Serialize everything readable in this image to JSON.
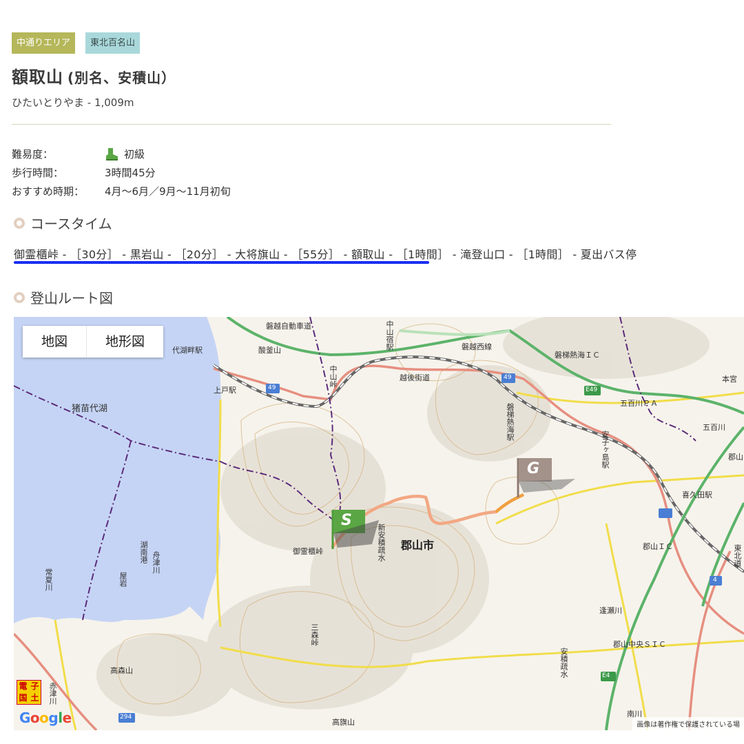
{
  "tags": [
    "中通りエリア",
    "東北百名山"
  ],
  "mountain": {
    "name": "額取山",
    "alias": "(別名、安積山）",
    "reading": "ひたいとりやま - 1,009m"
  },
  "info": {
    "difficulty_label": "難易度：",
    "difficulty_value": "初級",
    "walk_label": "歩行時間：",
    "walk_value": "3時間45分",
    "season_label": "おすすめ時期：",
    "season_value": "4月〜6月／9月〜11月初旬"
  },
  "sections": {
    "course_time": "コースタイム",
    "route_map": "登山ルート図"
  },
  "course": "御霊櫃峠 - ［30分］ - 黒岩山 - ［20分］ - 大将旗山 - ［55分］ - 額取山 - ［1時間］ - 滝登山口 - ［1時間］ - 夏出バス停",
  "map": {
    "tab_map": "地図",
    "tab_terrain": "地形図",
    "start_marker": "S",
    "goal_marker": "G",
    "labels": {
      "lake": "猪苗代湖",
      "city": "郡山市",
      "expressway": "磐越自動車道",
      "rail_west": "磐越西線",
      "rail_kaido": "越後街道",
      "ban_ic": "磐梯熱海ＩＣ",
      "pa": "五百川ＰＡ",
      "e49": "E49",
      "r49a": "49",
      "r49b": "49",
      "r4": "4",
      "r294": "294",
      "e4": "E4",
      "station_jozu": "上戸駅",
      "station_nakayama": "中山宿駅",
      "station_bandai": "磐梯熱海駅",
      "station_azako": "安子ヶ島駅",
      "station_kikuta": "喜久田駅",
      "koriyama_ic": "郡山ＩＣ",
      "koriyama_sic": "郡山中央ＳＩＣ",
      "pass": "御霊櫃峠",
      "canal": "新安積疏水",
      "canal2": "安積疏水",
      "nakayama_pass": "中山峠",
      "mitsumori": "三森峠",
      "takamori": "高森山",
      "takahata": "高旗山",
      "sukagaike": "酸釜山",
      "hon_miya": "本宮",
      "gohyakugawa": "五百川",
      "toose": "逢瀬川",
      "minami": "南川",
      "koriyama_right": "郡山",
      "lake_shore": "代湖畔駅",
      "joshu": "常夏川",
      "konan": "湖南港",
      "funatsu": "舟津川",
      "akatsu": "赤津川",
      "yoshi": "屋岩",
      "tohoku": "東北道"
    },
    "gsi": [
      "電",
      "子",
      "国",
      "土"
    ],
    "google": "Google",
    "copyright": "画像は著作権で保護されている場"
  },
  "colors": {
    "tag_area": "#b5b75a",
    "tag_100": "#a9d8da",
    "lake": "#c5d4f5",
    "route": "#f2a883",
    "highway": "#5cb36a",
    "underline": "#1a2ff0"
  }
}
